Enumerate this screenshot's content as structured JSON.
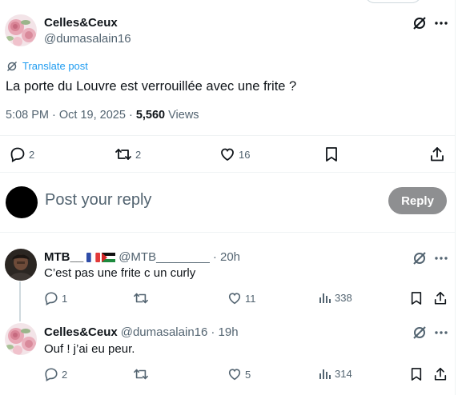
{
  "top_button": {},
  "post": {
    "author_name": "Celles&Ceux",
    "author_handle": "@dumasalain16",
    "translate_label": "Translate post",
    "text": "La porte du Louvre est verrouillée avec une frite ?",
    "time": "5:08 PM · Oct 19, 2025 · ",
    "views_count": "5,560",
    "views_label": " Views",
    "replies": "2",
    "reposts": "2",
    "likes": "16"
  },
  "composer": {
    "placeholder": "Post your reply",
    "button_label": "Reply"
  },
  "replies": [
    {
      "name": "MTB__",
      "handle": "@MTB________",
      "time": "· 20h",
      "text": "C’est pas une frite c un curly",
      "replies": "1",
      "reposts": "",
      "likes": "11",
      "views": "338"
    },
    {
      "name": "Celles&Ceux",
      "handle": "@dumasalain16",
      "time": "· 19h",
      "text": "Ouf ! j’ai eu peur.",
      "replies": "2",
      "reposts": "",
      "likes": "5",
      "views": "314"
    }
  ],
  "icons": {
    "reply": "reply-icon",
    "repost": "repost-icon",
    "like": "heart-icon",
    "bookmark": "bookmark-icon",
    "share": "share-icon",
    "views": "views-icon",
    "grok": "grok-icon",
    "more": "more-icon",
    "translate": "translate-icon"
  },
  "colors": {
    "link": "#1d9bf0",
    "text": "#0f1419",
    "secondary": "#536471",
    "reply_button": "#8e8f91"
  }
}
